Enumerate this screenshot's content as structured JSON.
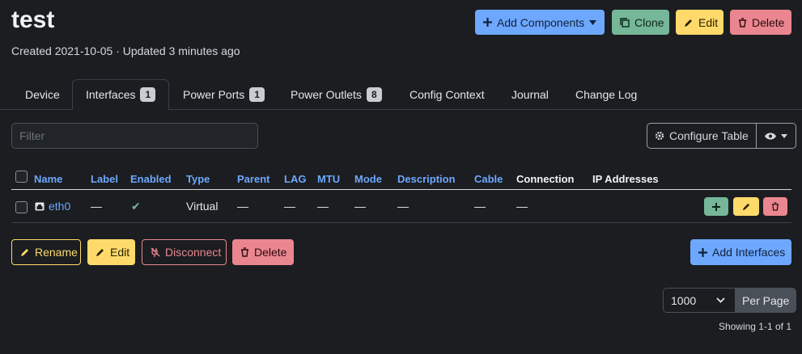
{
  "page": {
    "title": "test",
    "meta": "Created 2021-10-05 · Updated 3 minutes ago"
  },
  "header_buttons": {
    "add_components": "Add Components",
    "clone": "Clone",
    "edit": "Edit",
    "delete": "Delete"
  },
  "tabs": [
    {
      "label": "Device",
      "badge": ""
    },
    {
      "label": "Interfaces",
      "badge": "1",
      "active": true
    },
    {
      "label": "Power Ports",
      "badge": "1"
    },
    {
      "label": "Power Outlets",
      "badge": "8"
    },
    {
      "label": "Config Context",
      "badge": ""
    },
    {
      "label": "Journal",
      "badge": ""
    },
    {
      "label": "Change Log",
      "badge": ""
    }
  ],
  "filter": {
    "placeholder": "Filter",
    "value": ""
  },
  "configure_table": "Configure Table",
  "table": {
    "columns": [
      "Name",
      "Label",
      "Enabled",
      "Type",
      "Parent",
      "LAG",
      "MTU",
      "Mode",
      "Description",
      "Cable",
      "Connection",
      "IP Addresses"
    ],
    "rows": [
      {
        "name": "eth0",
        "label": "—",
        "enabled": "✔",
        "type": "Virtual",
        "parent": "—",
        "lag": "—",
        "mtu": "—",
        "mode": "—",
        "description": "—",
        "cable": "—",
        "connection": "—",
        "ip_addresses": ""
      }
    ]
  },
  "bulk_actions": {
    "rename": "Rename",
    "edit": "Edit",
    "disconnect": "Disconnect",
    "delete": "Delete",
    "add_interfaces": "Add Interfaces"
  },
  "pagination": {
    "per_page_value": "1000",
    "per_page_label": "Per Page",
    "showing": "Showing 1-1 of 1"
  },
  "colors": {
    "primary": "#6ea8fe",
    "success": "#75b798",
    "warning": "#ffda6a",
    "danger": "#ea868f",
    "background": "#1b1d21"
  }
}
